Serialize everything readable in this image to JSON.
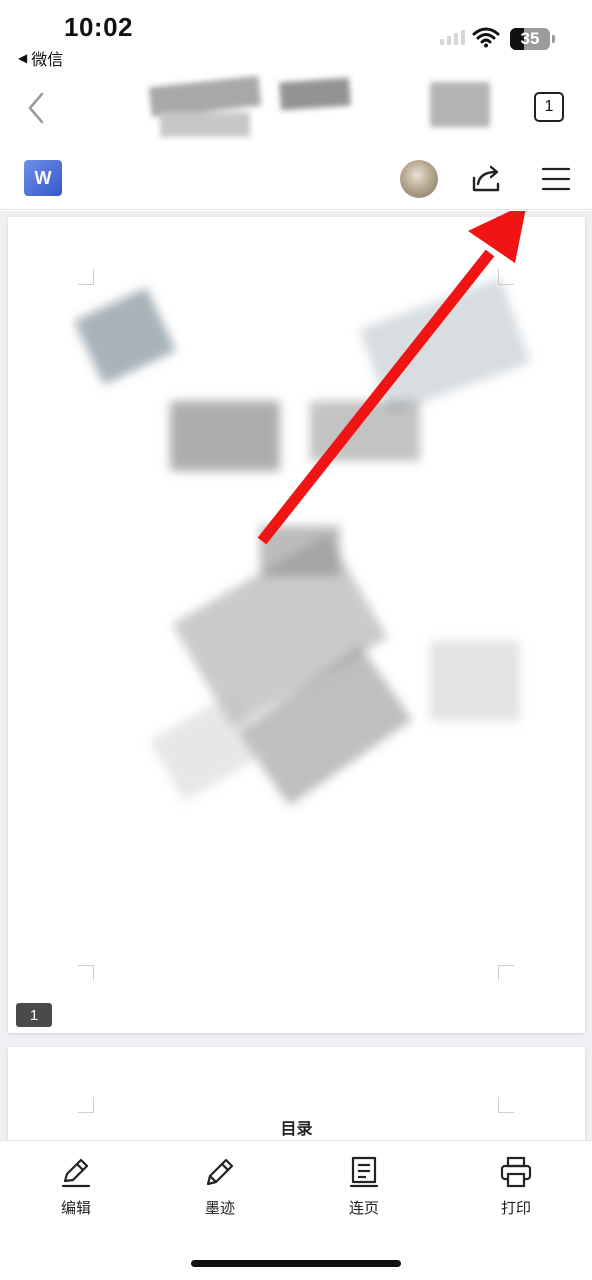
{
  "status_bar": {
    "time": "10:02",
    "back_app": "微信",
    "battery_level": "35",
    "battery_fraction": 0.35
  },
  "nav": {
    "tab_count": "1"
  },
  "toolbar": {
    "doc_icon_letter": "W"
  },
  "document": {
    "page_number": "1",
    "toc_title": "目录"
  },
  "bottom_bar": {
    "items": [
      {
        "label": "编辑",
        "icon": "pen-icon"
      },
      {
        "label": "墨迹",
        "icon": "pencil-icon"
      },
      {
        "label": "连页",
        "icon": "continuous-page-icon"
      },
      {
        "label": "打印",
        "icon": "printer-icon"
      }
    ]
  },
  "annotation": {
    "arrow_color": "#f01414"
  }
}
